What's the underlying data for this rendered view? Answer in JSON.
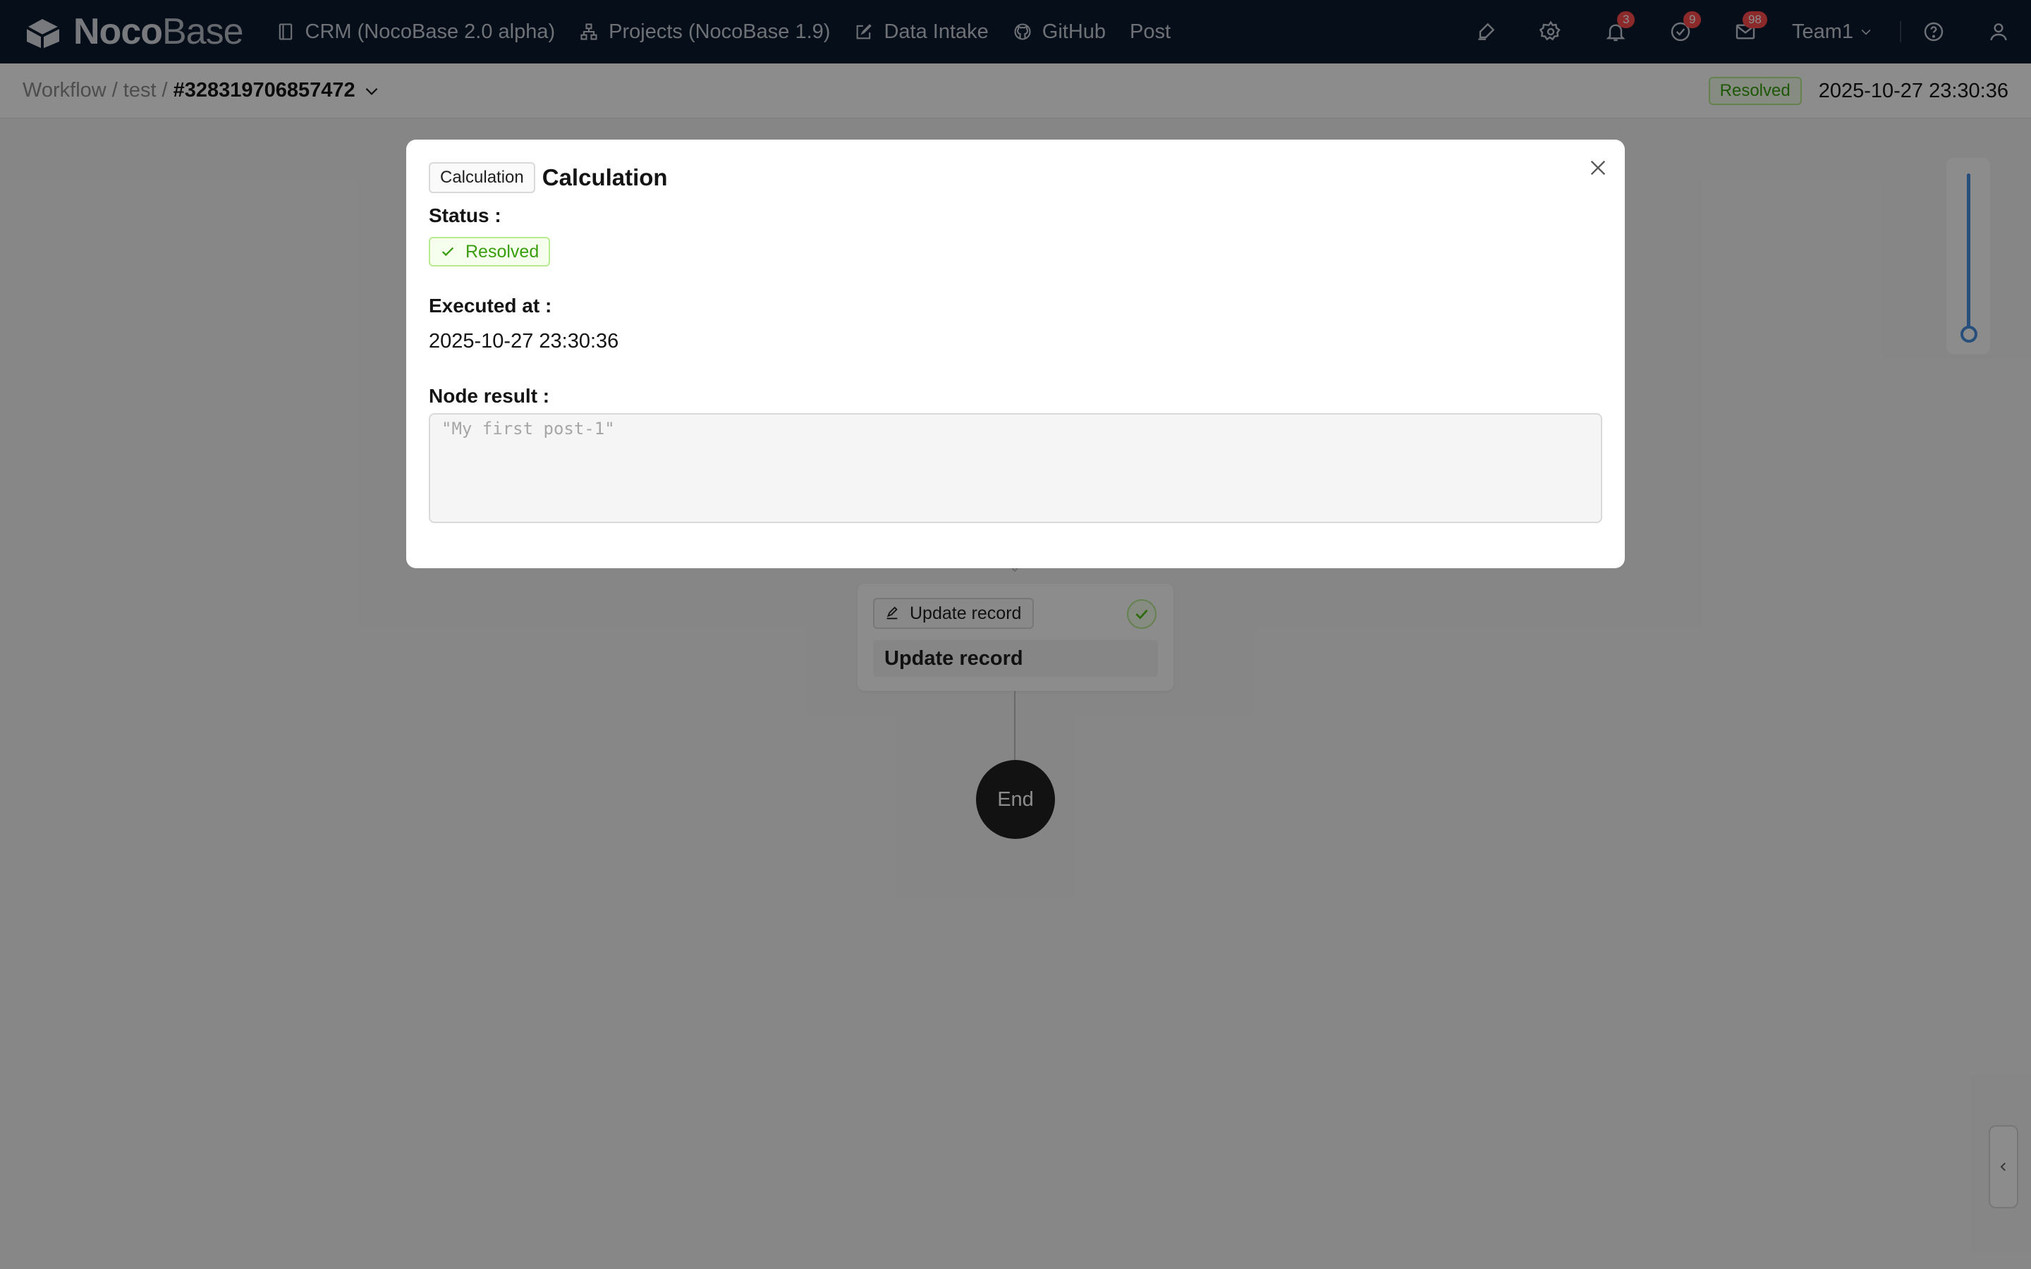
{
  "app": {
    "logo_text_bold": "Noco",
    "logo_text_light": "Base"
  },
  "nav": {
    "items": [
      {
        "label": "CRM (NocoBase 2.0 alpha)",
        "icon": "book-icon"
      },
      {
        "label": "Projects (NocoBase 1.9)",
        "icon": "sitemap-icon"
      },
      {
        "label": "Data Intake",
        "icon": "edit-icon"
      },
      {
        "label": "GitHub",
        "icon": "github-icon"
      },
      {
        "label": "Post",
        "icon": ""
      }
    ]
  },
  "tools": {
    "notifications_count": "3",
    "tasks_count": "9",
    "messages_count": "98",
    "team_label": "Team1"
  },
  "breadcrumb": {
    "root": "Workflow",
    "sep1": "/",
    "workflow": "test",
    "sep2": "/",
    "execution": "#328319706857472"
  },
  "execution": {
    "status": "Resolved",
    "time": "2025-10-27 23:30:36"
  },
  "canvas": {
    "node_type_label": "Update record",
    "node_title": "Update record",
    "end_label": "End"
  },
  "modal": {
    "tag": "Calculation",
    "title": "Calculation",
    "status_label": "Status",
    "status_value": "Resolved",
    "executed_label": "Executed at",
    "executed_value": "2025-10-27 23:30:36",
    "result_label": "Node result",
    "result_value": "\"My first post-1\""
  },
  "colors": {
    "topbar": "#0c1a2f",
    "success": "#389e0d",
    "badge": "#ff4d4f",
    "accent": "#4a90e2"
  }
}
